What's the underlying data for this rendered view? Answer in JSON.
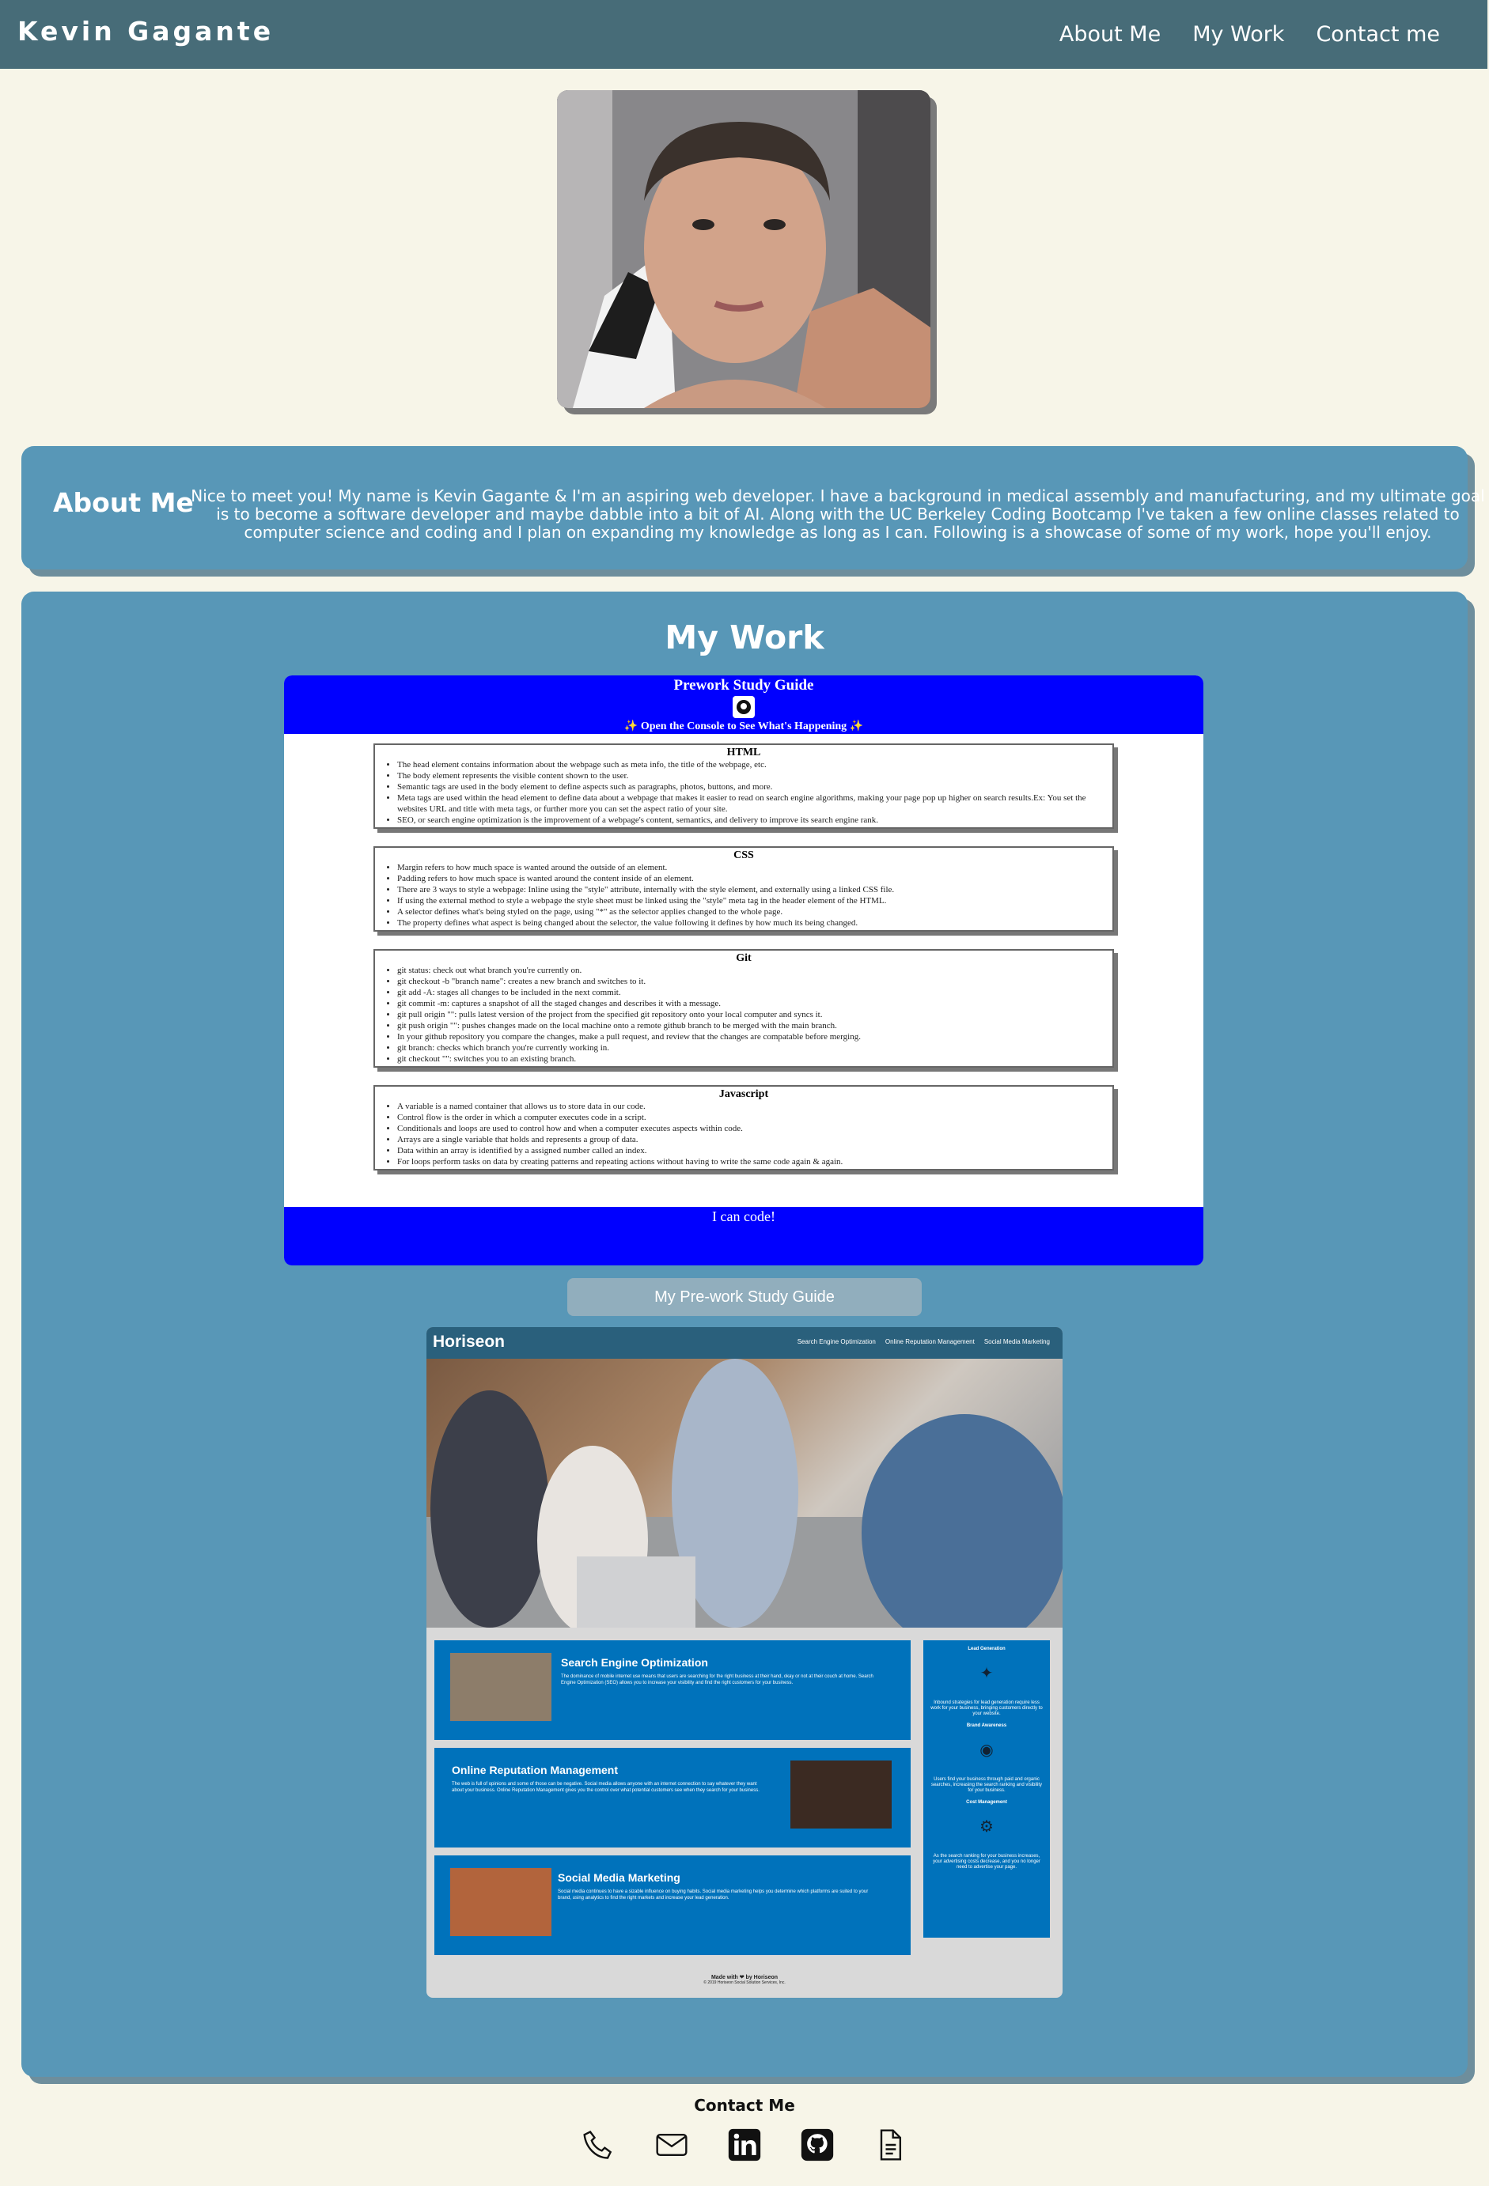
{
  "header": {
    "brand": "Kevin Gagante",
    "nav": [
      "About Me",
      "My Work",
      "Contact me"
    ]
  },
  "about": {
    "title": "About Me",
    "text": "Nice to meet you! My name is Kevin Gagante & I'm an aspiring web developer. I have a background in medical assembly and manufacturing, and my ultimate goal is to become a software developer and maybe dabble into a bit of AI. Along with the UC Berkeley Coding Bootcamp I've taken a few online classes related to computer science and coding and I plan on expanding my knowledge as long as I can. Following is a showcase of some of my work, hope you'll enjoy."
  },
  "work": {
    "title": "My Work",
    "guide": {
      "title": "Prework Study Guide",
      "subtitle": "✨ Open the Console to See What's Happening ✨",
      "sections": [
        {
          "heading": "HTML",
          "items": [
            "The head element contains information about the webpage such as meta info, the title of the webpage, etc.",
            "The body element represents the visible content shown to the user.",
            "Semantic tags are used in the body element to define aspects such as paragraphs, photos, buttons, and more.",
            "Meta tags are used within the head element to define data about a webpage that makes it easier to read on search engine algorithms, making your page pop up higher on search results.Ex: You set the websites URL and title with meta tags, or further more you can set the aspect ratio of your site.",
            "SEO, or search engine optimization is the improvement of a webpage's content, semantics, and delivery to improve its search engine rank."
          ]
        },
        {
          "heading": "CSS",
          "items": [
            "Margin refers to how much space is wanted around the outside of an element.",
            "Padding refers to how much space is wanted around the content inside of an element.",
            "There are 3 ways to style a webpage: Inline using the \"style\" attribute, internally with the style element, and externally using a linked CSS file.",
            "If using the external method to style a webpage the style sheet must be linked using the \"style\" meta tag in the header element of the HTML.",
            "A selector defines what's being styled on the page, using \"*\" as the selector applies changed to the whole page.",
            "The property defines what aspect is being changed about the selector, the value following it defines by how much its being changed."
          ]
        },
        {
          "heading": "Git",
          "items": [
            "git status: check out what branch you're currently on.",
            "git checkout -b \"branch name\": creates a new branch and switches to it.",
            "git add -A: stages all changes to be included in the next commit.",
            "git commit -m: captures a snapshot of all the staged changes and describes it with a message.",
            "git pull origin \"\": pulls latest version of the project from the specified git repository onto your local computer and syncs it.",
            "git push origin \"\": pushes changes made on the local machine onto a remote github branch to be merged with the main branch.",
            "In your github repository you compare the changes, make a pull request, and review that the changes are compatable before merging.",
            "git branch: checks which branch you're currently working in.",
            "git checkout \"\": switches you to an existing branch."
          ]
        },
        {
          "heading": "Javascript",
          "items": [
            "A variable is a named container that allows us to store data in our code.",
            "Control flow is the order in which a computer executes code in a script.",
            "Conditionals and loops are used to control how and when a computer executes aspects within code.",
            "Arrays are a single variable that holds and represents a group of data.",
            "Data within an array is identified by a assigned number called an index.",
            "For loops perform tasks on data by creating patterns and repeating actions without having to write the same code again & again."
          ]
        }
      ],
      "footer": "I can code!"
    },
    "button": "My Pre-work Study Guide",
    "horiseon": {
      "brand": "Horiseon",
      "nav": [
        "Search Engine Optimization",
        "Online Reputation Management",
        "Social Media Marketing"
      ],
      "cards": [
        {
          "title": "Search Engine Optimization",
          "text": "The dominance of mobile internet use means that users are searching for the right business at their hand, okay or not at their couch at home. Search Engine Optimization (SEO) allows you to increase your visibility and find the right customers for your business."
        },
        {
          "title": "Online Reputation Management",
          "text": "The web is full of opinions and some of those can be negative. Social media allows anyone with an internet connection to say whatever they want about your business. Online Reputation Management gives you the control over what potential customers see when they search for your business."
        },
        {
          "title": "Social Media Marketing",
          "text": "Social media continues to have a sizable influence on buying habits. Social media marketing helps you determine which platforms are suited to your brand, using analytics to find the right markets and increase your lead generation."
        }
      ],
      "side": [
        {
          "title": "Lead Generation",
          "text": "Inbound strategies for lead generation require less work for your business, bringing customers directly to your website."
        },
        {
          "title": "Brand Awareness",
          "text": "Users find your business through paid and organic searches, increasing the search ranking and visibility for your business."
        },
        {
          "title": "Cost Management",
          "text": "As the search ranking for your business increases, your advertising costs decrease, and you no longer need to advertise your page."
        }
      ],
      "footer_made": "Made with ❤ by Horiseon",
      "footer_copy": "© 2019 Horiseon Social Solution Services, Inc."
    }
  },
  "contact": {
    "title": "Contact Me",
    "icons": [
      "phone-icon",
      "mail-icon",
      "linkedin-icon",
      "github-icon",
      "resume-icon"
    ]
  }
}
